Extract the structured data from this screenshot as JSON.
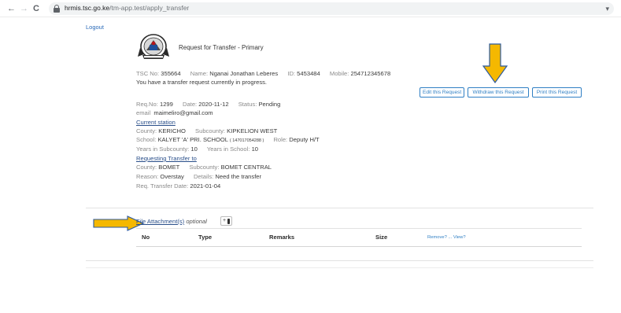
{
  "browser": {
    "back": "←",
    "forward": "→",
    "reload": "C",
    "url_domain": "hrmis.tsc.go.ke",
    "url_path": "/tm-app.test/apply_transfer"
  },
  "header": {
    "logout": "Logout",
    "title": "Request for Transfer - Primary"
  },
  "teacher": {
    "tsc_label": "TSC No:",
    "tsc_no": "355664",
    "name_label": "Name:",
    "name": "Nganai Jonathan Leberes",
    "id_label": "ID:",
    "id": "5453484",
    "mobile_label": "Mobile:",
    "mobile": "254712345678",
    "notice": "You have a transfer request currently in progress."
  },
  "actions": {
    "edit": "Edit this Request",
    "withdraw": "Withdraw this Request",
    "print": "Print this Request"
  },
  "request": {
    "reqno_label": "Req.No:",
    "reqno": "1299",
    "date_label": "Date:",
    "date": "2020-11-12",
    "status_label": "Status:",
    "status": "Pending",
    "email_label": "email",
    "email": "maimeliro@gmail.com"
  },
  "current": {
    "heading": "Current station",
    "county_label": "County:",
    "county": "KERICHO",
    "subcounty_label": "Subcounty:",
    "subcounty": "KIPKELION WEST",
    "school_label": "School:",
    "school": "KALYET 'A' PRI. SCHOOL",
    "school_code": "( 147017054288 )",
    "role_label": "Role:",
    "role": "Deputy H/T",
    "years_sub_label": "Years in Subcounty:",
    "years_sub": "10",
    "years_school_label": "Years in School:",
    "years_school": "10"
  },
  "requesting": {
    "heading": "Requesting Transfer to",
    "county_label": "County:",
    "county": "BOMET",
    "subcounty_label": "Subcounty:",
    "subcounty": "BOMET CENTRAL",
    "reason_label": "Reason:",
    "reason": "Overstay",
    "details_label": "Details:",
    "details": "Need the transfer",
    "date_label": "Req. Transfer Date:",
    "date": "2021-01-04"
  },
  "attachments": {
    "title": "File Attachment(s)",
    "optional": "optional",
    "add": "+",
    "columns": [
      "No",
      "Type",
      "Remarks",
      "Size"
    ],
    "remove_view": "Remove? ... View?"
  },
  "colors": {
    "arrow_fill": "#f5b800",
    "arrow_stroke": "#2c5aa0",
    "button_blue": "#2f7fc4"
  }
}
